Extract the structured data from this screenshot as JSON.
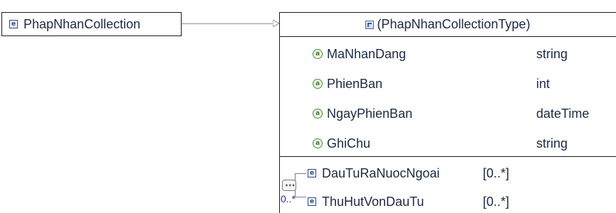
{
  "root": {
    "label": "PhapNhanCollection",
    "icon": "element-icon"
  },
  "type": {
    "title": "(PhapNhanCollectionType)",
    "attributes": [
      {
        "name": "MaNhanDang",
        "type": "string"
      },
      {
        "name": "PhienBan",
        "type": "int"
      },
      {
        "name": "NgayPhienBan",
        "type": "dateTime"
      },
      {
        "name": "GhiChu",
        "type": "string"
      }
    ],
    "sequence_multiplicity": "0..*",
    "children": [
      {
        "name": "DauTuRaNuocNgoai",
        "multiplicity": "[0..*]"
      },
      {
        "name": "ThuHutVonDauTu",
        "multiplicity": "[0..*]"
      }
    ]
  },
  "colors": {
    "border": "#1c1c1c",
    "text": "#1b2a44",
    "multiplicity_blue": "#1e2ea0"
  }
}
